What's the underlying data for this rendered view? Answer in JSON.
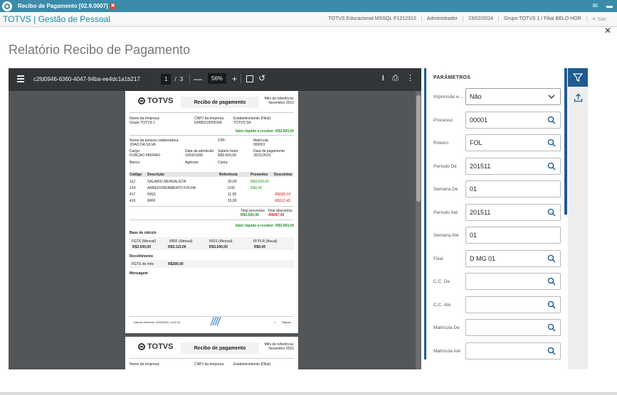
{
  "window": {
    "title": "Recibo de Pagamento [02.9.0007]",
    "close_glyph": "✖",
    "right_icons": [
      "mail-icon",
      "minimize-icon"
    ]
  },
  "appbar": {
    "brand": "TOTVS | Gestão de Pessoal",
    "env": "TOTVS Educacional MSSQL P1212310",
    "user": "Administrador",
    "date": "23/02/2024",
    "branch": "Grupo TOTVS 1 / Filial BELO HOR",
    "exit_label": "Sair"
  },
  "page": {
    "title": "Relatório Recibo de Pagamento",
    "close_glyph": "✕"
  },
  "viewer": {
    "doc_name": "c2fd0946-6360-4047-94ba-ee4dc1a1b217",
    "page_current": "1",
    "page_sep": "/",
    "page_total": "3",
    "zoom": "56%",
    "zoom_out": "—",
    "zoom_in": "+"
  },
  "receipt": {
    "logo_text": "TOTVS",
    "title": "Recibo de pagamento",
    "ref_label": "Mês de referência:",
    "ref_value": "Novembro 2015",
    "company_label": "Nome da empresa:",
    "company": "Grupo TOTVS 1",
    "cnpj_label": "CNPJ da empresa:",
    "cnpj": "53485215000106",
    "estab_label": "Estabelecimento (Filial):",
    "estab": "TOTVS SA",
    "liquid_label": "Valor líquido a receber: R$3.003,00",
    "employee_label": "Nome da pessoa colaboradora:",
    "employee": "JOAO DA SILVA",
    "cpf_label": "CPF:",
    "matricula_label": "Matrícula:",
    "matricula": "000001",
    "cargo_label": "Cargo:",
    "cargo": "FUNCAO PADRAO",
    "admissao_label": "Data da admissão:",
    "admissao": "10/03/1999",
    "salario_label": "Salário bruto:",
    "salario": "R$3.500,00",
    "pagamento_label": "Data de pagamento:",
    "pagamento": "30/11/2015",
    "banco_label": "Banco:",
    "banco": "-",
    "agencia_label": "Agência:",
    "conta_label": "Conta:",
    "columns": [
      "Código",
      "Descrição",
      "Referência",
      "Proventos",
      "Descontos"
    ],
    "rows": [
      {
        "code": "112",
        "desc": "SALARIO MENSALISTA",
        "ref": "30,00",
        "prov": "R$3.500,00",
        "desc_val": ""
      },
      {
        "code": "124",
        "desc": "ARREDONDAMENTO FOLHA",
        "ref": "0,00",
        "prov": "R$0,45",
        "desc_val": ""
      },
      {
        "code": "417",
        "desc": "INSS",
        "ref": "11,00",
        "prov": "",
        "desc_val": "-R$385,00"
      },
      {
        "code": "419",
        "desc": "IRRF",
        "ref": "15,00",
        "prov": "",
        "desc_val": "-R$112,45"
      }
    ],
    "total_prov_label": "Total proventos",
    "total_prov": "R$3.500,45",
    "total_desc_label": "Total descontos",
    "total_desc": "-R$497,45",
    "liquid_label2": "Valor líquido a receber: R$3.003,00",
    "base_title": "Base de cálculo",
    "base_cols": [
      "FGTS (Mensal)",
      "IRRF (Mensal)",
      "INSS (Mensal)",
      "IR PLR (Anual)"
    ],
    "base_vals": [
      "R$3.500,00",
      "R$3.115,00",
      "R$3.500,00",
      "R$0,00"
    ],
    "recolh_title": "Recolhimento",
    "fgts_mes_label": "FGTS do mês",
    "fgts_mes": "R$280,00",
    "mensagem_title": "Mensagem",
    "footer_date": "Data de referência: 23/02/2024 | 14:37:15",
    "footer_page": "1",
    "footer_pages": "Páginas"
  },
  "params": {
    "title": "PARÂMETROS",
    "fields": [
      {
        "label": "Impressão e...",
        "value": "Não",
        "kind": "select"
      },
      {
        "label": "Processo",
        "value": "00001",
        "kind": "lookup"
      },
      {
        "label": "Roteiro",
        "value": "FOL",
        "kind": "lookup"
      },
      {
        "label": "Período De",
        "value": "201511",
        "kind": "lookup"
      },
      {
        "label": "Semana De",
        "value": "01",
        "kind": "text"
      },
      {
        "label": "Período Até",
        "value": "201511",
        "kind": "lookup"
      },
      {
        "label": "Semana Até",
        "value": "01",
        "kind": "text"
      },
      {
        "label": "Filial",
        "value": "D MG 01",
        "kind": "lookup"
      },
      {
        "label": "C.C. De",
        "value": "",
        "kind": "lookup"
      },
      {
        "label": "C.C. Até",
        "value": "",
        "kind": "lookup"
      },
      {
        "label": "Matrícula De",
        "value": "",
        "kind": "lookup"
      },
      {
        "label": "Matrícula Até",
        "value": "",
        "kind": "lookup"
      }
    ]
  },
  "colors": {
    "titlebar": "#3b8caa",
    "brand": "#1a89a8",
    "accent": "#1e5b8f",
    "viewer_bg": "#525659",
    "viewer_toolbar": "#323639",
    "green": "#228b22",
    "red": "#cc2222"
  }
}
